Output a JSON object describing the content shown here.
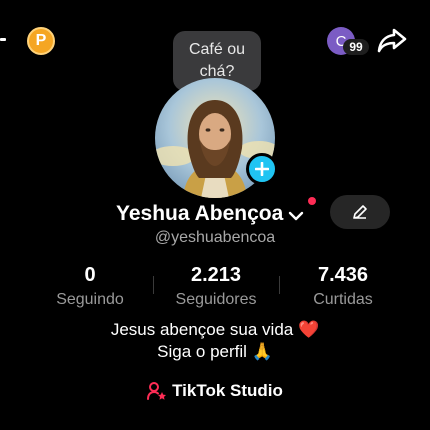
{
  "top_bar": {
    "coin_letter": "P",
    "notification_avatar_letter": "C",
    "notification_count": "99",
    "icons": [
      "back-arrow-icon",
      "coin-icon",
      "share-icon"
    ]
  },
  "tooltip": {
    "line1": "Café ou",
    "line2": "chá?"
  },
  "profile": {
    "display_name": "Yeshua Abençoa",
    "username": "@yeshuabencoa",
    "avatar_icon": "profile-photo",
    "add_icon": "plus-icon",
    "edit_icon": "pencil-icon"
  },
  "stats": [
    {
      "value": "0",
      "label": "Seguindo"
    },
    {
      "value": "2.213",
      "label": "Seguidores"
    },
    {
      "value": "7.436",
      "label": "Curtidas"
    }
  ],
  "bio": {
    "line1": "Jesus abençoe sua vida ❤️",
    "line2": "Siga o perfil 🙏"
  },
  "studio": {
    "label": "TikTok Studio",
    "icon": "user-star-icon"
  },
  "colors": {
    "background": "#000000",
    "accent_red": "#fe2c55",
    "plus_blue": "#20c4f2",
    "coin_orange": "#f5a623",
    "muted_text": "#9a9a9a"
  }
}
